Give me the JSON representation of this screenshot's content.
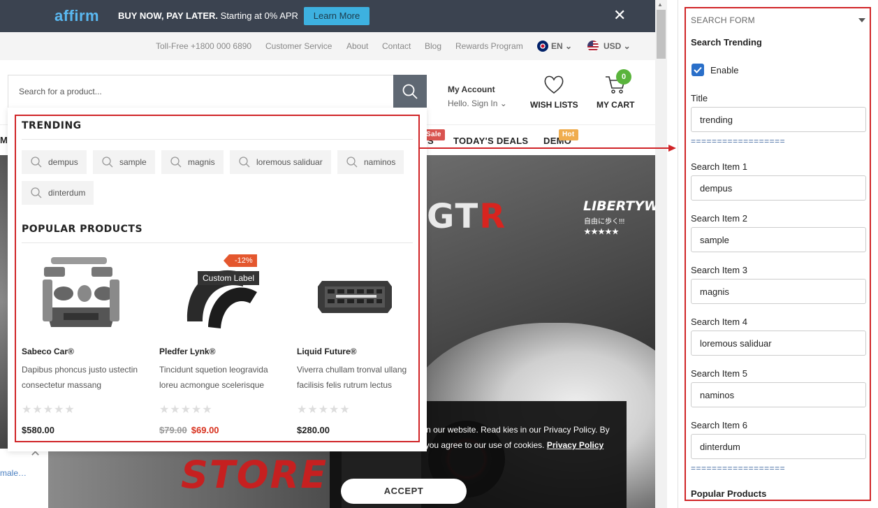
{
  "promo": {
    "brand": "affirm",
    "headline": "BUY NOW, PAY LATER.",
    "subline": " Starting at 0% APR",
    "cta": "Learn More"
  },
  "topbar": {
    "links": [
      "Toll-Free +1800 000 6890",
      "Customer Service",
      "About",
      "Contact",
      "Blog",
      "Rewards Program"
    ],
    "language": "EN",
    "currency": "USD"
  },
  "header": {
    "search_placeholder": "Search for a product...",
    "account_title": "My Account",
    "account_sub": "Hello. Sign In",
    "wishlist_label": "WISH LISTS",
    "cart_label": "MY CART",
    "cart_count": "0"
  },
  "nav": {
    "items": [
      "S",
      "TODAY'S DEALS",
      "DEMO"
    ],
    "sale_tag": "Sale",
    "hot_tag": "Hot",
    "left_partial": "MA"
  },
  "dropdown": {
    "trending_heading": "TRENDING",
    "trending": [
      "dempus",
      "sample",
      "magnis",
      "loremous saliduar",
      "naminos",
      "dinterdum"
    ],
    "popular_heading": "POPULAR PRODUCTS",
    "products": [
      {
        "name": "Sabeco Car®",
        "desc": "Dapibus phoncus justo ustectin consectetur massang",
        "price": "$580.00",
        "old_price": "",
        "badge": "",
        "label": ""
      },
      {
        "name": "Pledfer Lynk®",
        "desc": "Tincidunt squetion leogravida loreu acmongue scelerisque",
        "price": "$69.00",
        "old_price": "$79.00",
        "badge": "-12%",
        "label": "Custom Label"
      },
      {
        "name": "Liquid Future®",
        "desc": "Viverra chullam tronval ullang facilisis felis rutrum lectus",
        "price": "$280.00",
        "old_price": "",
        "badge": "",
        "label": ""
      }
    ],
    "stars": "★★★★★"
  },
  "hero": {
    "gtr_left": "GT",
    "gtr_right": "R",
    "brand": "LIBERTYWALK",
    "brand_sub": "自由に歩く!!!★★★★★",
    "store": "STORE"
  },
  "cookie": {
    "text": "rove your experience on our website. Read kies in our Privacy Policy. By browsing this website, you agree to our use of cookies.",
    "policy_link": "Privacy Policy",
    "accept": "ACCEPT"
  },
  "side": {
    "partial_link": "male…"
  },
  "panel": {
    "title": "SEARCH FORM",
    "section": "Search Trending",
    "enable_label": "Enable",
    "title_label": "Title",
    "title_value": "trending",
    "separator": "==================",
    "items": [
      {
        "label": "Search Item 1",
        "value": "dempus"
      },
      {
        "label": "Search Item 2",
        "value": "sample"
      },
      {
        "label": "Search Item 3",
        "value": "magnis"
      },
      {
        "label": "Search Item 4",
        "value": "loremous saliduar"
      },
      {
        "label": "Search Item 5",
        "value": "naminos"
      },
      {
        "label": "Search Item 6",
        "value": "dinterdum"
      }
    ],
    "popular_label": "Popular Products"
  },
  "colors": {
    "highlight": "#d02427",
    "promo_bg": "#3b4350",
    "cta_bg": "#3db1e0",
    "checkbox": "#2a6fc9",
    "cart_badge": "#5ab43c"
  }
}
